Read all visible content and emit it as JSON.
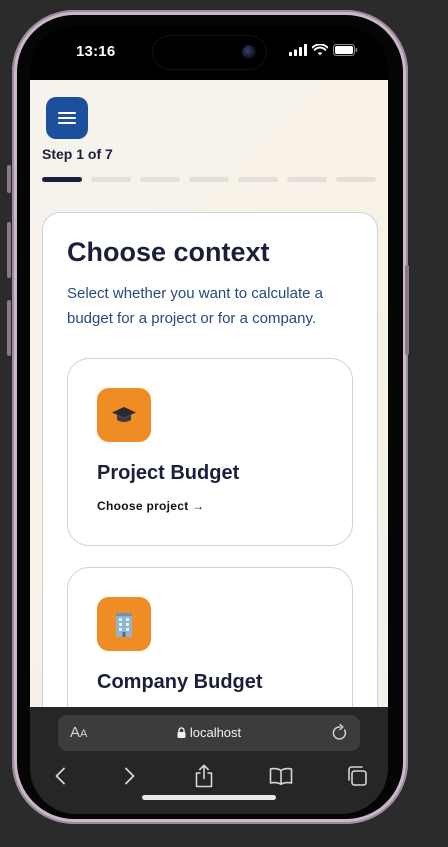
{
  "status": {
    "time": "13:16"
  },
  "header": {
    "step_label": "Step 1 of 7",
    "total_steps": 7,
    "current_step": 1
  },
  "card": {
    "title": "Choose context",
    "subtitle": "Select whether you want to calculate a budget for a project or for a company."
  },
  "options": [
    {
      "icon": "graduation-cap-icon",
      "title": "Project Budget",
      "link": "Choose project →"
    },
    {
      "icon": "office-building-icon",
      "title": "Company Budget"
    }
  ],
  "browser": {
    "aa_label_big": "A",
    "aa_label_small": "A",
    "url": "localhost"
  },
  "colors": {
    "menu": "#1d4f9f",
    "accent": "#f08c24",
    "ink": "#1a1f3b",
    "subtitle": "#27497f"
  }
}
